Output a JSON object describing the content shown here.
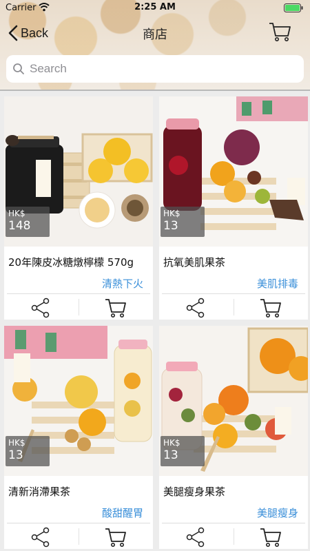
{
  "status_bar": {
    "carrier": "Carrier",
    "time": "2:25 AM"
  },
  "nav": {
    "back_label": "Back",
    "title": "商店"
  },
  "search": {
    "placeholder": "Search",
    "value": ""
  },
  "colors": {
    "tag": "#3a8fd9",
    "badge": "#505050"
  },
  "products": [
    {
      "name": "20年陳皮冰糖燉檸檬 570g",
      "tag": "清熱下火",
      "currency": "HK$",
      "price": "148"
    },
    {
      "name": "抗氧美肌果茶",
      "tag": "美肌排毒",
      "currency": "HK$",
      "price": "13"
    },
    {
      "name": "清新消滯果茶",
      "tag": "酸甜醒胃",
      "currency": "HK$",
      "price": "13"
    },
    {
      "name": "美腿瘦身果茶",
      "tag": "美腿瘦身",
      "currency": "HK$",
      "price": "13"
    }
  ],
  "icons": {
    "back": "chevron-left-icon",
    "cart": "cart-icon",
    "share": "share-icon",
    "search": "search-icon",
    "wifi": "wifi-icon",
    "battery": "battery-icon"
  }
}
